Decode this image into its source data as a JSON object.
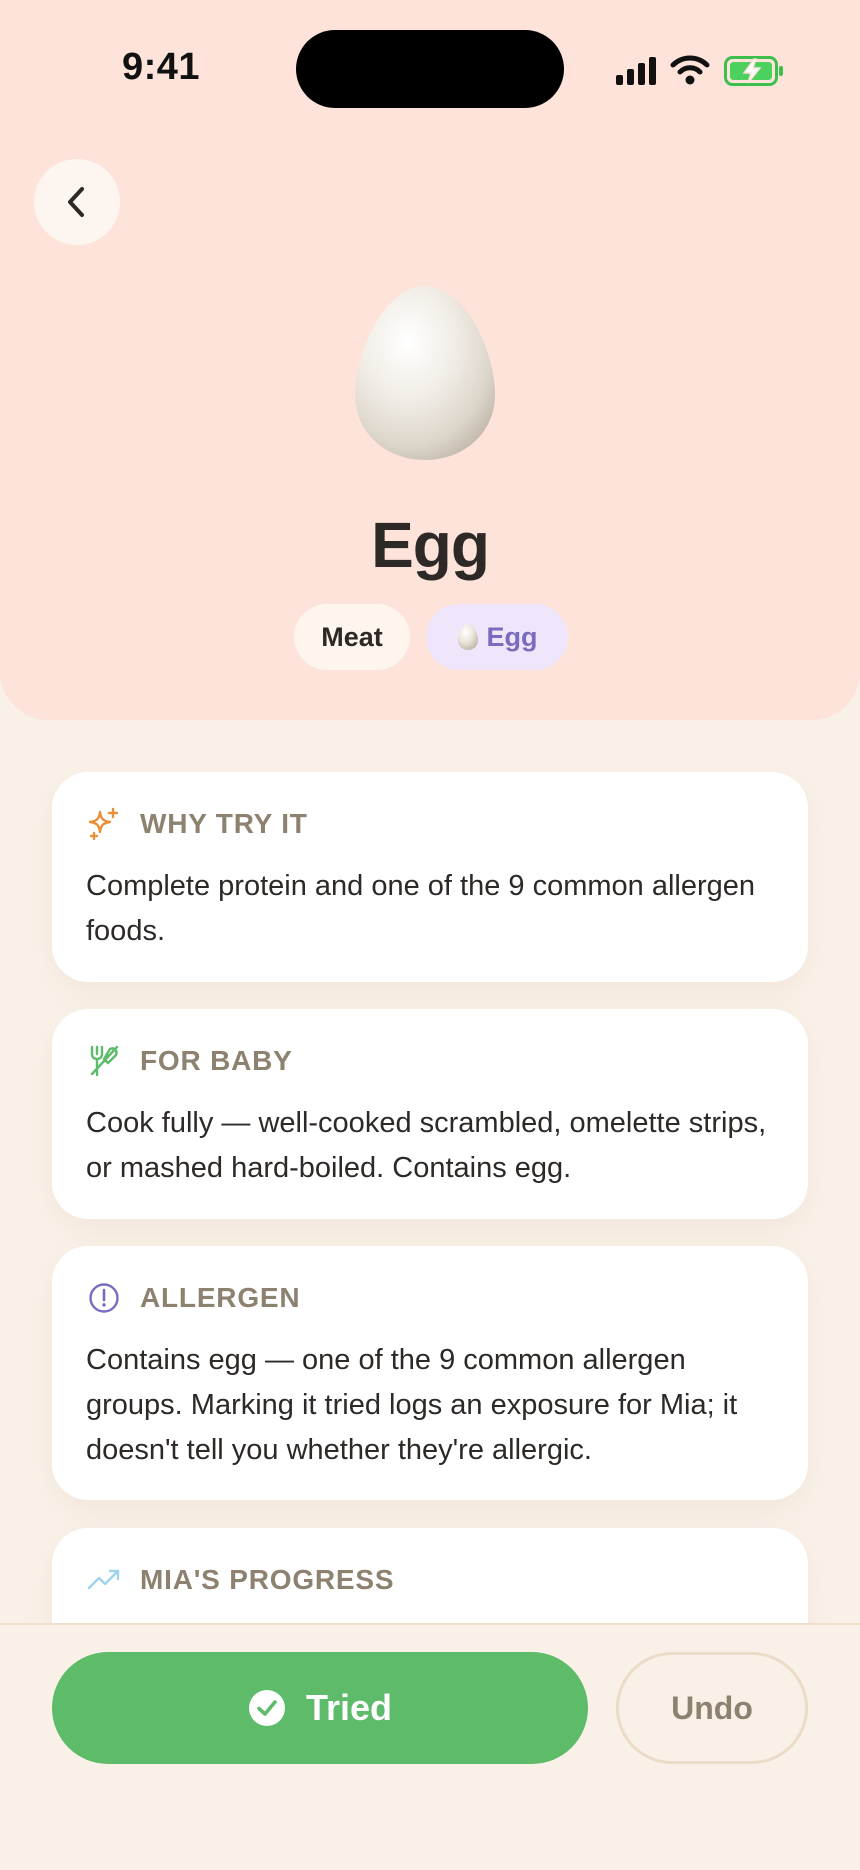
{
  "status_bar": {
    "time": "9:41",
    "icons": [
      "cellular-signal-icon",
      "wifi-icon",
      "battery-charging-icon"
    ]
  },
  "header": {
    "back_icon": "chevron-left-icon",
    "food_name": "Egg",
    "image_icon": "egg-icon",
    "chips": [
      {
        "label": "Meat"
      },
      {
        "label": "Egg",
        "icon": "egg-icon"
      }
    ]
  },
  "cards": [
    {
      "icon": "sparkles-icon",
      "title": "WHY TRY IT",
      "text": "Complete protein and one of the 9 common allergen foods."
    },
    {
      "icon": "utensils-icon",
      "title": "FOR BABY",
      "text": "Cook fully — well-cooked scrambled, omelette strips, or mashed hard-boiled. Contains egg."
    },
    {
      "icon": "alert-circle-icon",
      "title": "ALLERGEN",
      "text": "Contains egg — one of the 9 common allergen groups. Marking it tried logs an exposure for Mia; it doesn't tell you whether they're allergic."
    },
    {
      "icon": "trending-up-icon",
      "title": "MIA'S PROGRESS"
    }
  ],
  "actions": {
    "tried_label": "Tried",
    "tried_icon": "check-circle-icon",
    "undo_label": "Undo"
  },
  "colors": {
    "hero_background": "#fde3da",
    "page_background": "#f9f1e8",
    "primary_green": "#5dbb6a",
    "allergen_purple": "#7b6bbf",
    "muted_label": "#8d8170",
    "sparkle_orange": "#e8913a"
  }
}
